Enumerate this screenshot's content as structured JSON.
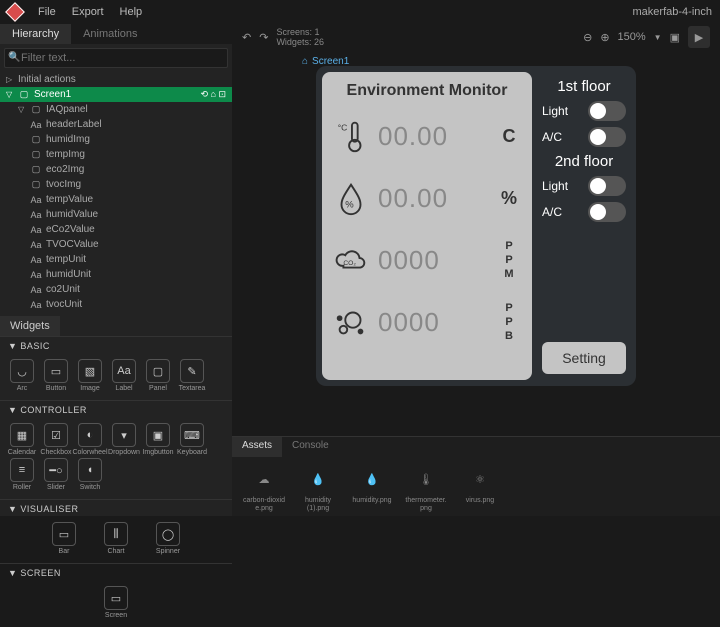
{
  "menu": {
    "file": "File",
    "export": "Export",
    "help": "Help",
    "project": "makerfab-4-inch"
  },
  "leftTabs": {
    "hierarchy": "Hierarchy",
    "animations": "Animations"
  },
  "filter": {
    "placeholder": "Filter text..."
  },
  "tree": {
    "initial": "Initial actions",
    "screen": "Screen1",
    "panel": "IAQpanel",
    "items": [
      "headerLabel",
      "humidImg",
      "tempImg",
      "eco2Img",
      "tvocImg",
      "tempValue",
      "humidValue",
      "eCo2Value",
      "TVOCValue",
      "tempUnit",
      "humidUnit",
      "co2Unit",
      "tvocUnit"
    ]
  },
  "widgets": {
    "tab": "Widgets",
    "basic": {
      "head": "BASIC",
      "items": [
        "Arc",
        "Button",
        "Image",
        "Label",
        "Panel",
        "Textarea"
      ]
    },
    "controller": {
      "head": "CONTROLLER",
      "items": [
        "Calendar",
        "Checkbox",
        "Colorwheel",
        "Dropdown",
        "Imgbutton",
        "Keyboard",
        "Roller",
        "Slider",
        "Switch"
      ]
    },
    "visualiser": {
      "head": "VISUALISER",
      "items": [
        "Bar",
        "Chart",
        "Spinner"
      ]
    },
    "screen": {
      "head": "SCREEN",
      "items": [
        "Screen"
      ]
    }
  },
  "toolbar": {
    "screens": "Screens:",
    "screensN": "1",
    "widgets": "Widgets:",
    "widgetsN": "26",
    "zoom": "150%"
  },
  "crumb": {
    "label": "Screen1"
  },
  "device": {
    "title": "Environment Monitor",
    "rows": [
      {
        "value": "00.00",
        "unit": "C"
      },
      {
        "value": "00.00",
        "unit": "%"
      },
      {
        "value": "0000",
        "unit": "P\nP\nM"
      },
      {
        "value": "0000",
        "unit": "P\nP\nB"
      }
    ],
    "floor1": "1st floor",
    "floor2": "2nd floor",
    "light": "Light",
    "ac": "A/C",
    "setting": "Setting"
  },
  "assets": {
    "tab1": "Assets",
    "tab2": "Console",
    "items": [
      "carbon-dioxid e.png",
      "humidity (1).png",
      "humidity.png",
      "thermometer. png",
      "virus.png"
    ]
  }
}
